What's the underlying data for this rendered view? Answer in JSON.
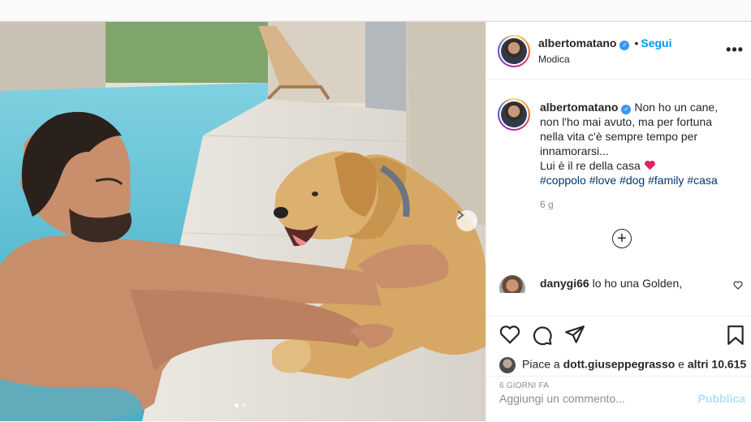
{
  "post": {
    "author": "albertomatano",
    "follow_label": "Segui",
    "separator": "•",
    "subtitle": "Modica",
    "more_label": "•••",
    "caption_lines": [
      "Non ho un cane,",
      "non l'ho mai avuto, ma per fortuna",
      "nella vita c'è sempre tempo per",
      "innamorarsi...",
      "Lui è il re della casa"
    ],
    "hashtags": [
      "#coppolo",
      "#love",
      "#dog",
      "#family",
      "#casa"
    ],
    "time_ago": "6 g",
    "load_more_label": "+",
    "comment": {
      "user": "danygi66",
      "text": "lo ho una Golden,"
    },
    "likes": {
      "prefix": "Piace a ",
      "user": "dott.giuseppegrasso",
      "middle": " e ",
      "others": "altri 10.615"
    },
    "date": "6 GIORNI FA",
    "add_comment_placeholder": "Aggiungi un commento...",
    "publish_label": "Pubblica",
    "carousel": {
      "slides": 2,
      "active_index": 0
    }
  },
  "icons": {
    "verified": "verified-badge-icon",
    "like": "heart-icon",
    "comment": "comment-icon",
    "share": "paper-plane-icon",
    "save": "bookmark-icon",
    "next": "chevron-right-icon",
    "caption_heart": "red-heart-emoji"
  },
  "colors": {
    "link": "#0095f6",
    "hashtag": "#00376b",
    "muted": "#8e8e8e",
    "publish_disabled": "#b2dffc",
    "heart_emoji": "#e0245e"
  }
}
